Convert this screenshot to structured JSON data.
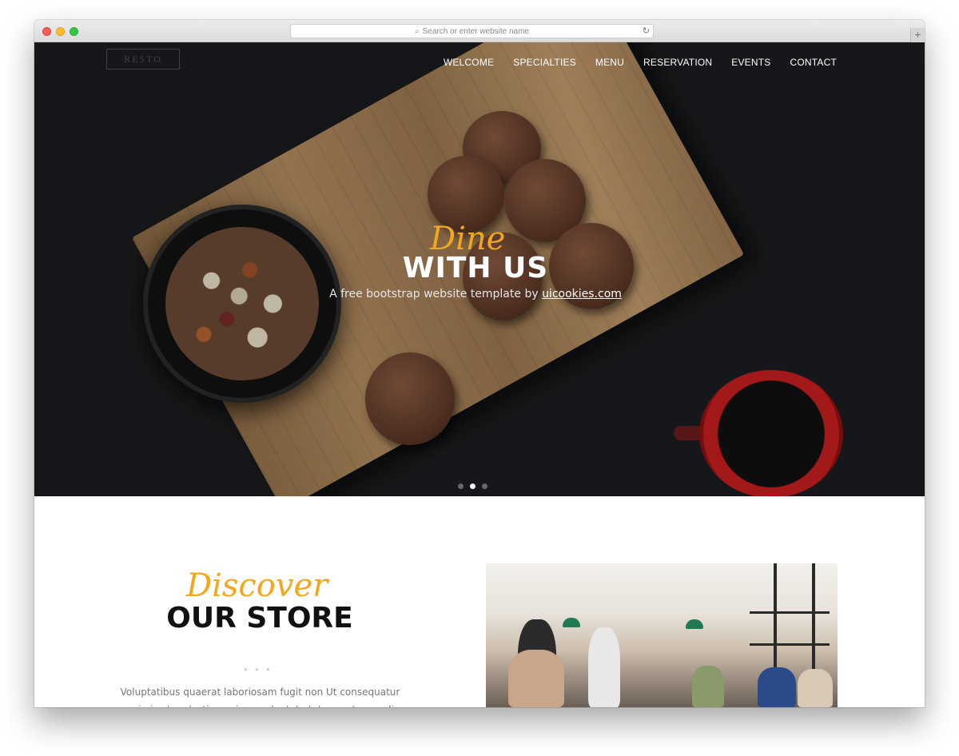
{
  "browser": {
    "address_placeholder": "Search or enter website name",
    "search_icon": "search-icon",
    "reload_icon": "reload-icon"
  },
  "nav": {
    "items": [
      "WELCOME",
      "SPECIALTIES",
      "MENU",
      "RESERVATION",
      "EVENTS",
      "CONTACT"
    ]
  },
  "hero": {
    "script_word": "Dine",
    "title": "WITH US",
    "subtitle_prefix": "A free bootstrap website template by ",
    "subtitle_link": "uicookies.com",
    "slide_count": 3,
    "active_slide": 2
  },
  "about": {
    "script_word": "Discover",
    "title": "OUR STORE",
    "divider": "* * *",
    "text": "Voluptatibus quaerat laboriosam fugit non Ut consequatur animi est molestiae enim a voluptate totam natus modi debitis dicta"
  },
  "colors": {
    "accent": "#f3a71c",
    "hero_bg": "#1b1d20"
  }
}
